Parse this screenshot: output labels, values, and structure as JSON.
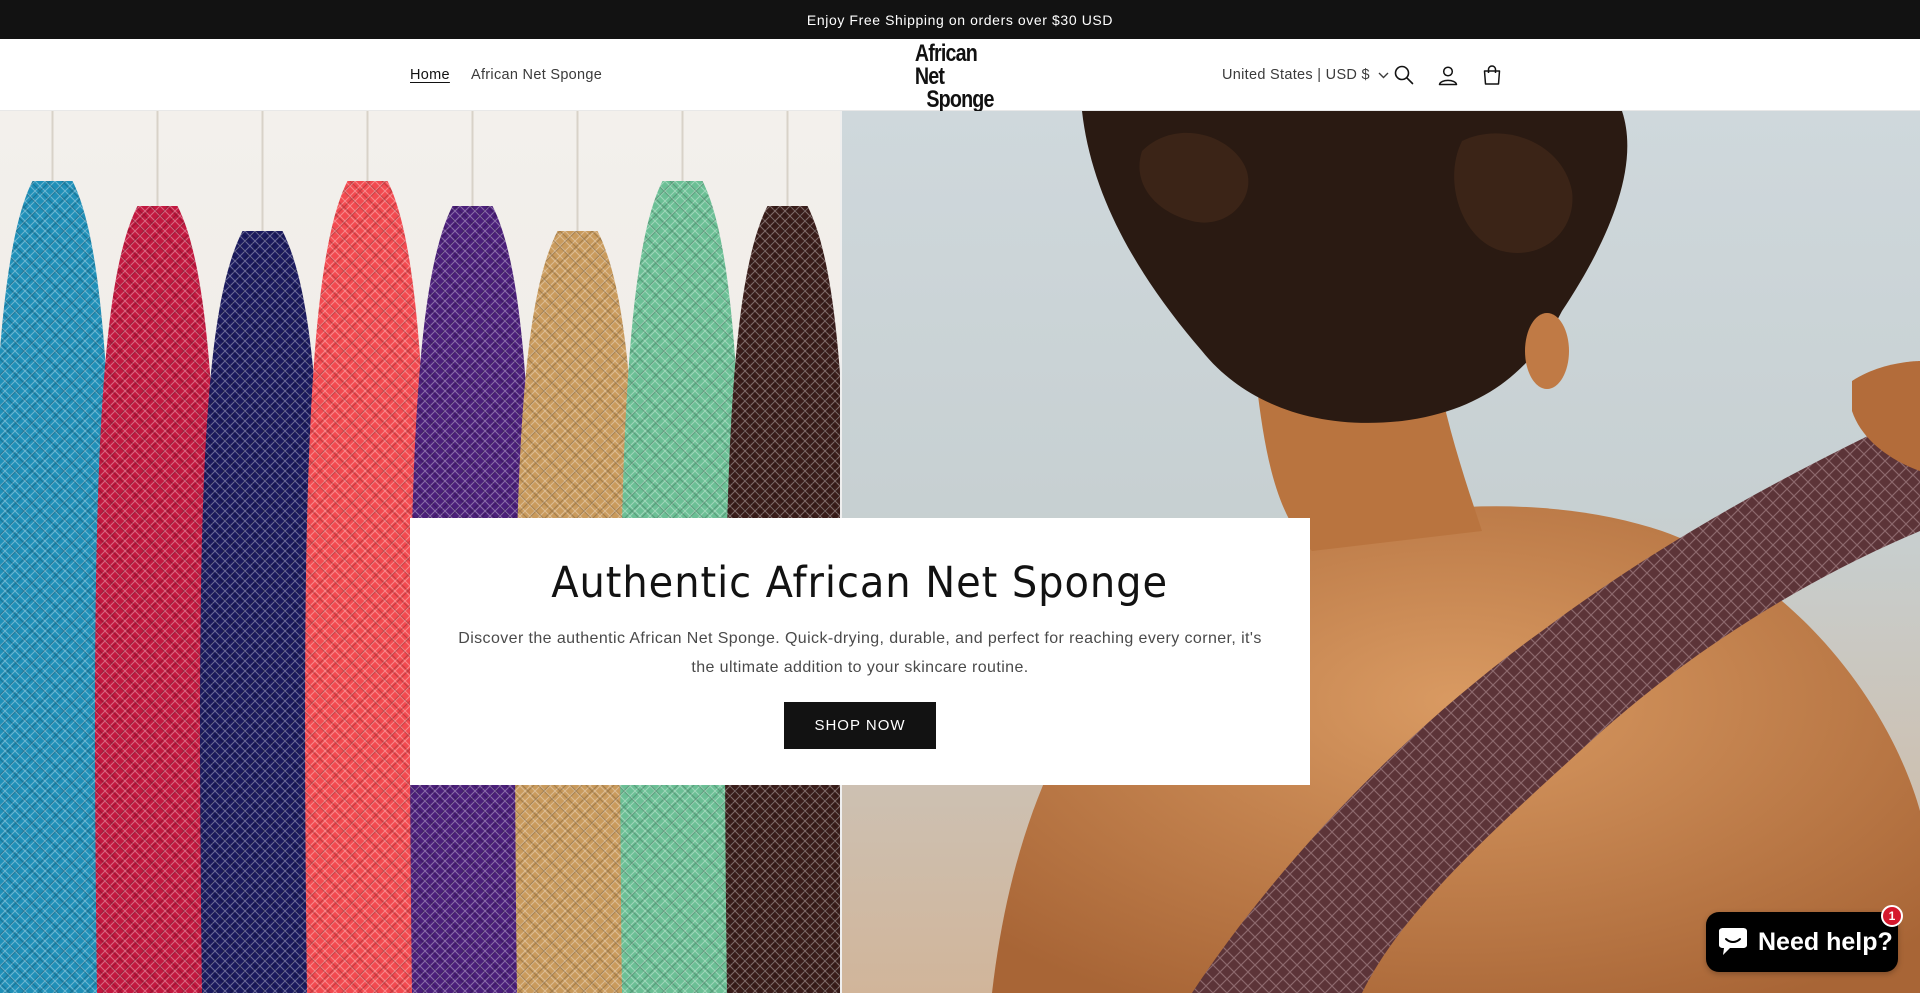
{
  "announcement": {
    "text": "Enjoy Free Shipping on orders over $30 USD"
  },
  "header": {
    "nav": [
      {
        "label": "Home",
        "active": true
      },
      {
        "label": "African Net Sponge",
        "active": false
      }
    ],
    "logo": {
      "line1": "African Net",
      "line2": "Sponge"
    },
    "country_selector": "United States | USD $",
    "icons": [
      "search-icon",
      "account-icon",
      "cart-icon"
    ]
  },
  "hero": {
    "left_image": "colorful-net-sponges-hanging",
    "right_image": "woman-using-net-sponge-on-back",
    "sponge_colors": [
      "#1f8fb8",
      "#c2183f",
      "#1b1a5e",
      "#f2494f",
      "#4b1f7a",
      "#c99a5c",
      "#6bbf95",
      "#3a1d1a"
    ],
    "title": "Authentic African Net Sponge",
    "description": "Discover the authentic African Net Sponge. Quick-drying, durable, and perfect for reaching every corner, it's the ultimate addition to your skincare routine.",
    "cta_label": "SHOP NOW"
  },
  "chat_widget": {
    "label": "Need help?",
    "badge_count": "1",
    "icon": "chat-bubble-icon"
  },
  "colors": {
    "announcement_bg": "#121212",
    "button_bg": "#121212",
    "badge": "#d5182d"
  }
}
